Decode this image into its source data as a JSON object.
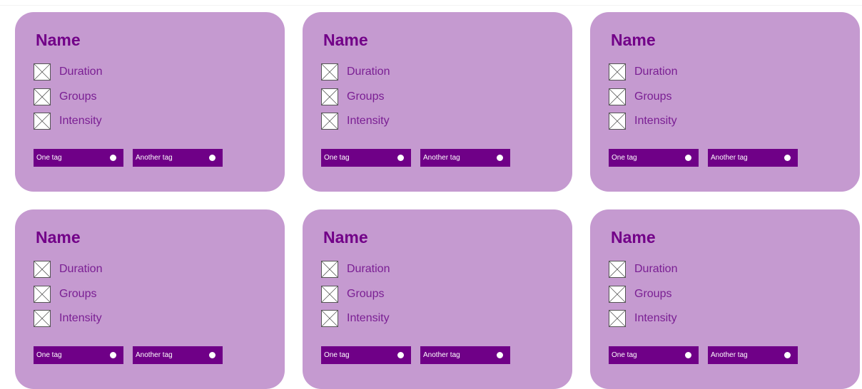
{
  "cards": [
    {
      "title": "Name",
      "attributes": [
        {
          "label": "Duration",
          "icon": "image-placeholder-icon"
        },
        {
          "label": "Groups",
          "icon": "image-placeholder-icon"
        },
        {
          "label": "Intensity",
          "icon": "image-placeholder-icon"
        }
      ],
      "tags": [
        {
          "label": "One tag",
          "icon": "dot-icon"
        },
        {
          "label": "Another tag",
          "icon": "dot-icon"
        }
      ]
    },
    {
      "title": "Name",
      "attributes": [
        {
          "label": "Duration",
          "icon": "image-placeholder-icon"
        },
        {
          "label": "Groups",
          "icon": "image-placeholder-icon"
        },
        {
          "label": "Intensity",
          "icon": "image-placeholder-icon"
        }
      ],
      "tags": [
        {
          "label": "One tag",
          "icon": "dot-icon"
        },
        {
          "label": "Another tag",
          "icon": "dot-icon"
        }
      ]
    },
    {
      "title": "Name",
      "attributes": [
        {
          "label": "Duration",
          "icon": "image-placeholder-icon"
        },
        {
          "label": "Groups",
          "icon": "image-placeholder-icon"
        },
        {
          "label": "Intensity",
          "icon": "image-placeholder-icon"
        }
      ],
      "tags": [
        {
          "label": "One tag",
          "icon": "dot-icon"
        },
        {
          "label": "Another tag",
          "icon": "dot-icon"
        }
      ]
    },
    {
      "title": "Name",
      "attributes": [
        {
          "label": "Duration",
          "icon": "image-placeholder-icon"
        },
        {
          "label": "Groups",
          "icon": "image-placeholder-icon"
        },
        {
          "label": "Intensity",
          "icon": "image-placeholder-icon"
        }
      ],
      "tags": [
        {
          "label": "One tag",
          "icon": "dot-icon"
        },
        {
          "label": "Another tag",
          "icon": "dot-icon"
        }
      ]
    },
    {
      "title": "Name",
      "attributes": [
        {
          "label": "Duration",
          "icon": "image-placeholder-icon"
        },
        {
          "label": "Groups",
          "icon": "image-placeholder-icon"
        },
        {
          "label": "Intensity",
          "icon": "image-placeholder-icon"
        }
      ],
      "tags": [
        {
          "label": "One tag",
          "icon": "dot-icon"
        },
        {
          "label": "Another tag",
          "icon": "dot-icon"
        }
      ]
    },
    {
      "title": "Name",
      "attributes": [
        {
          "label": "Duration",
          "icon": "image-placeholder-icon"
        },
        {
          "label": "Groups",
          "icon": "image-placeholder-icon"
        },
        {
          "label": "Intensity",
          "icon": "image-placeholder-icon"
        }
      ],
      "tags": [
        {
          "label": "One tag",
          "icon": "dot-icon"
        },
        {
          "label": "Another tag",
          "icon": "dot-icon"
        }
      ]
    }
  ],
  "colors": {
    "card_background": "#c59ad0",
    "title": "#720088",
    "attribute_text": "#7a1f93",
    "tag_background": "#6f0087",
    "tag_text": "#ffffff"
  }
}
